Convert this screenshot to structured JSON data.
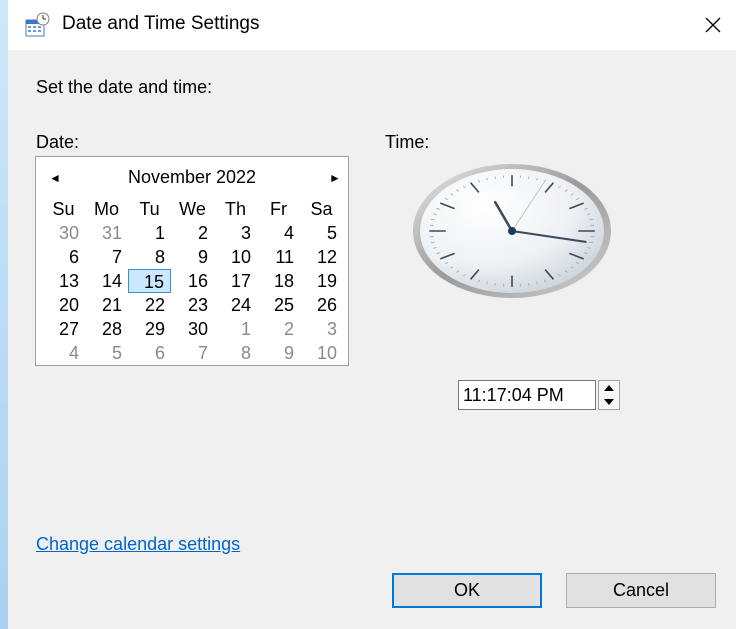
{
  "window": {
    "title": "Date and Time Settings",
    "icon": "calendar-clock-icon"
  },
  "prompt": "Set the date and time:",
  "date_label": "Date:",
  "time_label": "Time:",
  "calendar": {
    "month_label": "November 2022",
    "prev_glyph": "◄",
    "next_glyph": "►",
    "weekdays": [
      "Su",
      "Mo",
      "Tu",
      "We",
      "Th",
      "Fr",
      "Sa"
    ],
    "weeks": [
      [
        {
          "d": "30",
          "other": true
        },
        {
          "d": "31",
          "other": true
        },
        {
          "d": "1"
        },
        {
          "d": "2"
        },
        {
          "d": "3"
        },
        {
          "d": "4"
        },
        {
          "d": "5"
        }
      ],
      [
        {
          "d": "6"
        },
        {
          "d": "7"
        },
        {
          "d": "8"
        },
        {
          "d": "9"
        },
        {
          "d": "10"
        },
        {
          "d": "11"
        },
        {
          "d": "12"
        }
      ],
      [
        {
          "d": "13"
        },
        {
          "d": "14"
        },
        {
          "d": "15",
          "selected": true
        },
        {
          "d": "16"
        },
        {
          "d": "17"
        },
        {
          "d": "18"
        },
        {
          "d": "19"
        }
      ],
      [
        {
          "d": "20"
        },
        {
          "d": "21"
        },
        {
          "d": "22"
        },
        {
          "d": "23"
        },
        {
          "d": "24"
        },
        {
          "d": "25"
        },
        {
          "d": "26"
        }
      ],
      [
        {
          "d": "27"
        },
        {
          "d": "28"
        },
        {
          "d": "29"
        },
        {
          "d": "30"
        },
        {
          "d": "1",
          "other": true
        },
        {
          "d": "2",
          "other": true
        },
        {
          "d": "3",
          "other": true
        }
      ],
      [
        {
          "d": "4",
          "other": true
        },
        {
          "d": "5",
          "other": true
        },
        {
          "d": "6",
          "other": true
        },
        {
          "d": "7",
          "other": true
        },
        {
          "d": "8",
          "other": true
        },
        {
          "d": "9",
          "other": true
        },
        {
          "d": "10",
          "other": true
        }
      ]
    ],
    "selected_day": "15"
  },
  "clock": {
    "hour": 11,
    "minute": 17,
    "second": 4
  },
  "time_value": "11:17:04 PM",
  "change_calendar_link": "Change calendar settings",
  "ok_label": "OK",
  "cancel_label": "Cancel",
  "colors": {
    "accent": "#0078d7",
    "link": "#0066cc",
    "selected_day_bg": "#cce8ff",
    "dialog_bg": "#f0f0f0"
  }
}
